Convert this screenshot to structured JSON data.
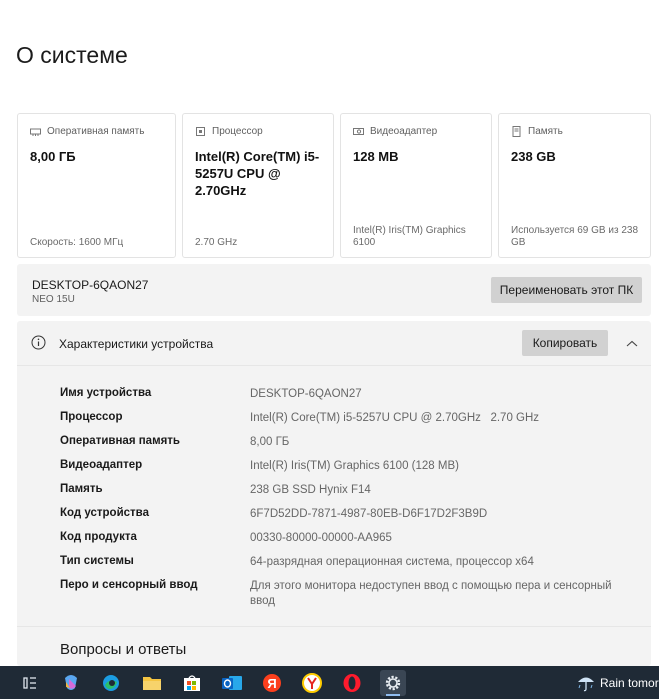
{
  "page": {
    "title": "О системе"
  },
  "cards": [
    {
      "icon": "memory-icon",
      "label": "Оперативная память",
      "value": "8,00 ГБ",
      "sub": "Скорость: 1600 МГц"
    },
    {
      "icon": "processor-icon",
      "label": "Процессор",
      "value": "Intel(R) Core(TM) i5-5257U CPU @ 2.70GHz",
      "sub": "2.70 GHz"
    },
    {
      "icon": "gpu-icon",
      "label": "Видеоадаптер",
      "value": "128 MB",
      "sub": "Intel(R) Iris(TM) Graphics 6100"
    },
    {
      "icon": "storage-icon",
      "label": "Память",
      "value": "238 GB",
      "sub": "Используется 69 GB из 238 GB"
    }
  ],
  "device": {
    "name": "DESKTOP-6QAON27",
    "model": "NEO 15U",
    "rename_label": "Переименовать этот ПК"
  },
  "specs": {
    "title": "Характеристики устройства",
    "copy_label": "Копировать",
    "rows": [
      {
        "label": "Имя устройства",
        "value": "DESKTOP-6QAON27"
      },
      {
        "label": "Процессор",
        "value": "Intel(R) Core(TM) i5-5257U CPU @ 2.70GHz   2.70 GHz"
      },
      {
        "label": "Оперативная память",
        "value": "8,00 ГБ"
      },
      {
        "label": "Видеоадаптер",
        "value": "Intel(R) Iris(TM) Graphics 6100 (128 MB)"
      },
      {
        "label": "Память",
        "value": "238 GB SSD Hynix F14"
      },
      {
        "label": "Код устройства",
        "value": "6F7D52DD-7871-4987-80EB-D6F17D2F3B9D"
      },
      {
        "label": "Код продукта",
        "value": "00330-80000-00000-AA965"
      },
      {
        "label": "Тип системы",
        "value": "64-разрядная операционная система, процессор x64"
      },
      {
        "label": "Перо и сенсорный ввод",
        "value": "Для этого монитора недоступен ввод с помощью пера и сенсорный ввод"
      }
    ]
  },
  "faq": {
    "title": "Вопросы и ответы"
  },
  "taskbar": {
    "apps": [
      "task-view-icon",
      "copilot-icon",
      "edge-icon",
      "file-explorer-icon",
      "microsoft-store-icon",
      "outlook-icon",
      "yandex-icon",
      "yandex-browser-icon",
      "opera-icon",
      "settings-icon"
    ],
    "weather_text": "Rain tomor"
  },
  "colors": {
    "accent": "#d1d1d1",
    "panel": "#f3f3f3",
    "taskbar": "#1f2a36"
  }
}
